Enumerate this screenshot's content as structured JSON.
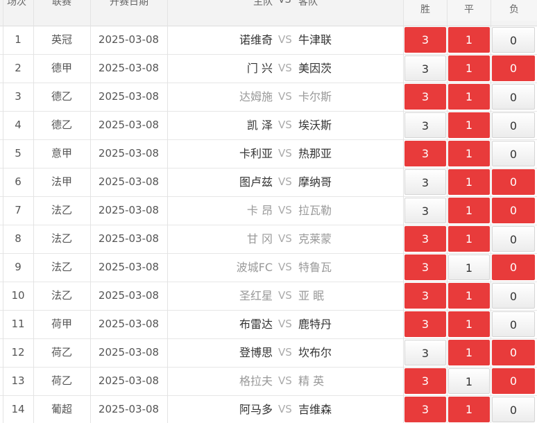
{
  "header": {
    "num": "场次",
    "league": "联赛",
    "date": "开赛日期",
    "home": "主队",
    "vs": "VS",
    "away": "客队",
    "win": "胜",
    "draw": "平",
    "loss": "负"
  },
  "colors": {
    "selected": "#e83b3b",
    "unselected": "#f4f4f4"
  },
  "rows": [
    {
      "num": "1",
      "league": "英冠",
      "date": "2025-03-08",
      "home": "诺维奇",
      "away": "牛津联",
      "win": "3",
      "draw": "1",
      "loss": "0",
      "sel_win": true,
      "sel_draw": true,
      "sel_loss": false,
      "dim": false
    },
    {
      "num": "2",
      "league": "德甲",
      "date": "2025-03-08",
      "home": "门 兴",
      "away": "美因茨",
      "win": "3",
      "draw": "1",
      "loss": "0",
      "sel_win": false,
      "sel_draw": true,
      "sel_loss": true,
      "dim": false
    },
    {
      "num": "3",
      "league": "德乙",
      "date": "2025-03-08",
      "home": "达姆施",
      "away": "卡尔斯",
      "win": "3",
      "draw": "1",
      "loss": "0",
      "sel_win": true,
      "sel_draw": true,
      "sel_loss": false,
      "dim": true
    },
    {
      "num": "4",
      "league": "德乙",
      "date": "2025-03-08",
      "home": "凯 泽",
      "away": "埃沃斯",
      "win": "3",
      "draw": "1",
      "loss": "0",
      "sel_win": false,
      "sel_draw": true,
      "sel_loss": false,
      "dim": false
    },
    {
      "num": "5",
      "league": "意甲",
      "date": "2025-03-08",
      "home": "卡利亚",
      "away": "热那亚",
      "win": "3",
      "draw": "1",
      "loss": "0",
      "sel_win": true,
      "sel_draw": true,
      "sel_loss": false,
      "dim": false
    },
    {
      "num": "6",
      "league": "法甲",
      "date": "2025-03-08",
      "home": "图卢兹",
      "away": "摩纳哥",
      "win": "3",
      "draw": "1",
      "loss": "0",
      "sel_win": false,
      "sel_draw": true,
      "sel_loss": true,
      "dim": false
    },
    {
      "num": "7",
      "league": "法乙",
      "date": "2025-03-08",
      "home": "卡 昂",
      "away": "拉瓦勒",
      "win": "3",
      "draw": "1",
      "loss": "0",
      "sel_win": false,
      "sel_draw": true,
      "sel_loss": true,
      "dim": true
    },
    {
      "num": "8",
      "league": "法乙",
      "date": "2025-03-08",
      "home": "甘 冈",
      "away": "克莱蒙",
      "win": "3",
      "draw": "1",
      "loss": "0",
      "sel_win": true,
      "sel_draw": true,
      "sel_loss": false,
      "dim": true
    },
    {
      "num": "9",
      "league": "法乙",
      "date": "2025-03-08",
      "home": "波城FC",
      "away": "特鲁瓦",
      "win": "3",
      "draw": "1",
      "loss": "0",
      "sel_win": true,
      "sel_draw": false,
      "sel_loss": true,
      "dim": true
    },
    {
      "num": "10",
      "league": "法乙",
      "date": "2025-03-08",
      "home": "圣红星",
      "away": "亚 眠",
      "win": "3",
      "draw": "1",
      "loss": "0",
      "sel_win": true,
      "sel_draw": true,
      "sel_loss": false,
      "dim": true
    },
    {
      "num": "11",
      "league": "荷甲",
      "date": "2025-03-08",
      "home": "布雷达",
      "away": "鹿特丹",
      "win": "3",
      "draw": "1",
      "loss": "0",
      "sel_win": true,
      "sel_draw": true,
      "sel_loss": false,
      "dim": false
    },
    {
      "num": "12",
      "league": "荷乙",
      "date": "2025-03-08",
      "home": "登博思",
      "away": "坎布尔",
      "win": "3",
      "draw": "1",
      "loss": "0",
      "sel_win": false,
      "sel_draw": true,
      "sel_loss": true,
      "dim": false
    },
    {
      "num": "13",
      "league": "荷乙",
      "date": "2025-03-08",
      "home": "格拉夫",
      "away": "精 英",
      "win": "3",
      "draw": "1",
      "loss": "0",
      "sel_win": true,
      "sel_draw": false,
      "sel_loss": true,
      "dim": true
    },
    {
      "num": "14",
      "league": "葡超",
      "date": "2025-03-08",
      "home": "阿马多",
      "away": "吉维森",
      "win": "3",
      "draw": "1",
      "loss": "0",
      "sel_win": true,
      "sel_draw": true,
      "sel_loss": false,
      "dim": false
    }
  ]
}
